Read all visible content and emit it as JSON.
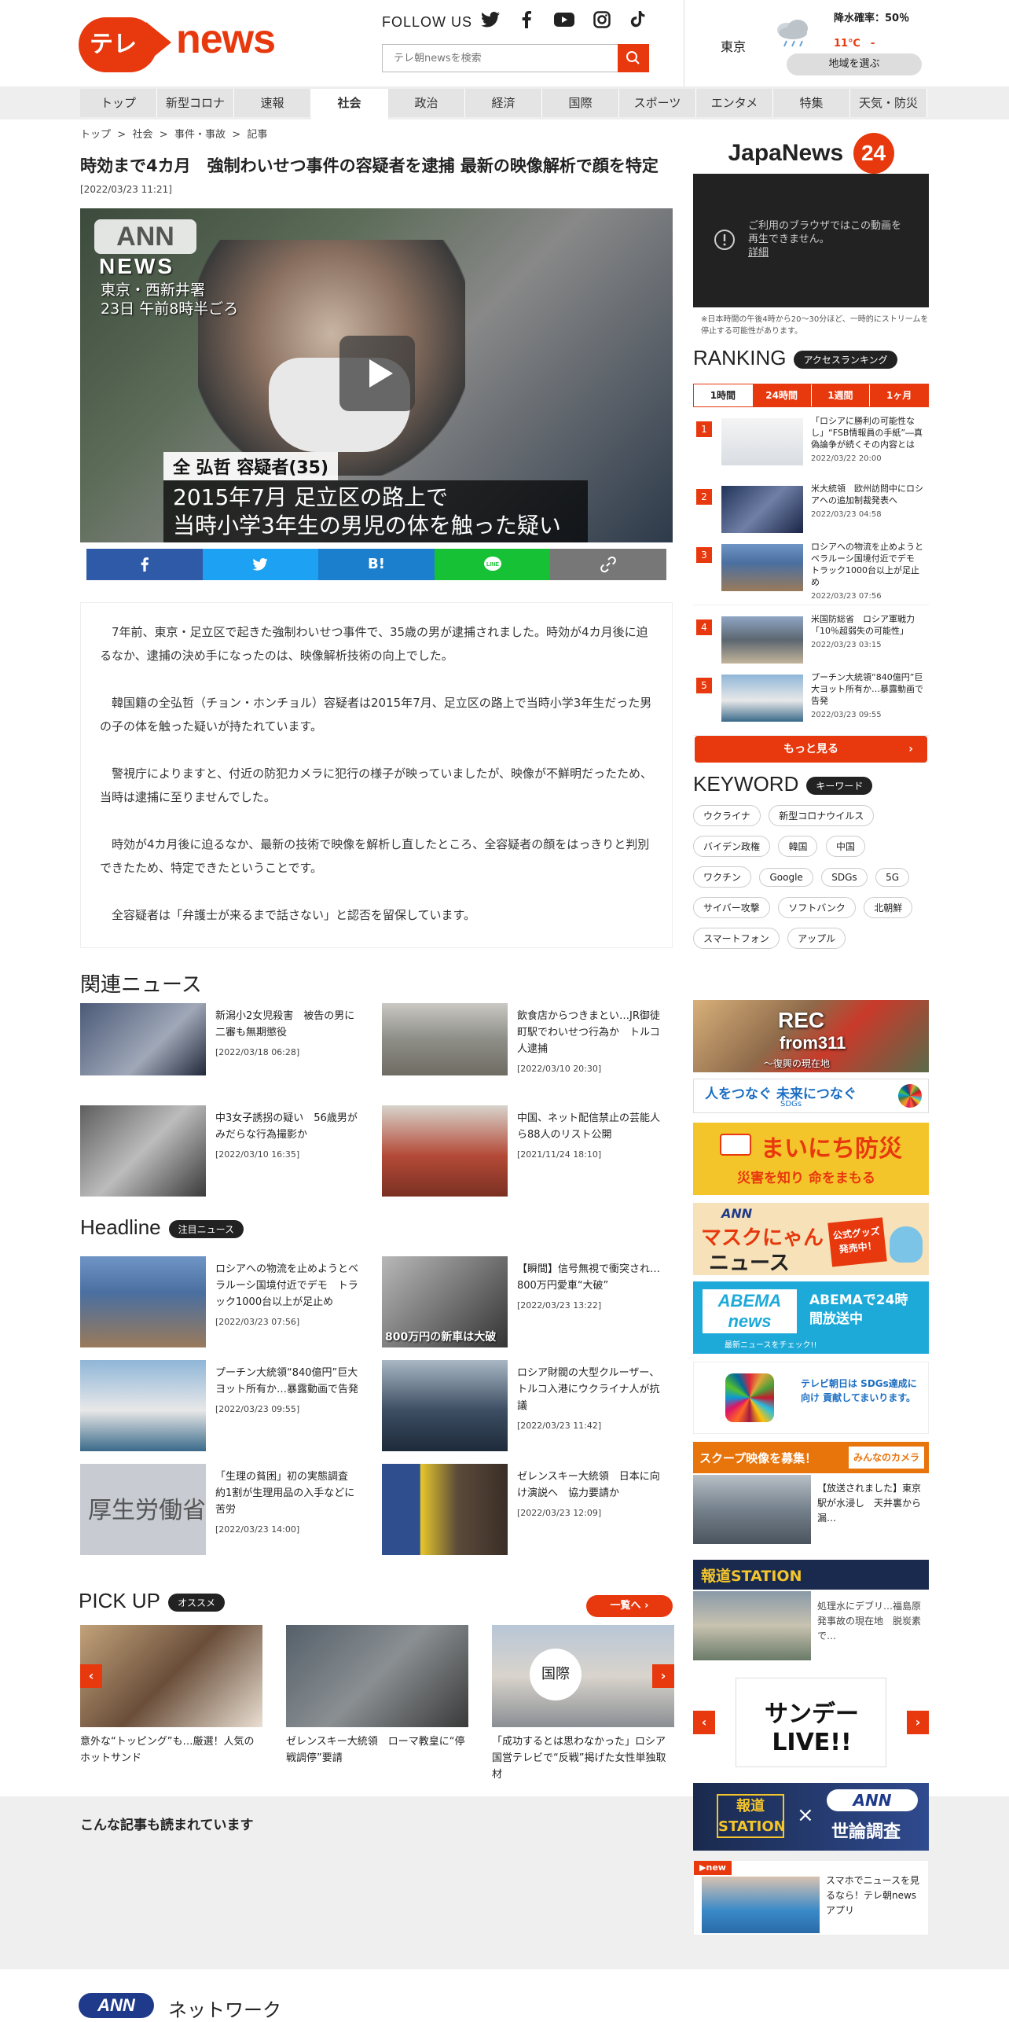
{
  "header": {
    "logo_pill": "テレ朝",
    "logo_word": "news",
    "follow_us": "FOLLOW US",
    "search_placeholder": "テレ朝newsを検索",
    "weather": {
      "city": "東京",
      "rain": "降水確率：50％",
      "temp": "11℃　-",
      "select_region": "地域を選ぶ"
    }
  },
  "nav": [
    "トップ",
    "新型コロナ",
    "速報",
    "社会",
    "政治",
    "経済",
    "国際",
    "スポーツ",
    "エンタメ",
    "特集",
    "天気・防災"
  ],
  "breadcrumb": [
    "トップ",
    "社会",
    "事件・事故",
    "記事"
  ],
  "article": {
    "title": "時効まで4カ月　強制わいせつ事件の容疑者を逮捕 最新の映像解析で顔を特定",
    "date": "[2022/03/23 11:21]",
    "video": {
      "logo": "ANN",
      "logo_sub": "NEWS",
      "location": "東京・西新井署",
      "time": "23日 午前8時半ごろ",
      "name_caption": "全 弘哲 容疑者(35)",
      "caption_line1": "2015年7月 足立区の路上で",
      "caption_line2": "当時小学3年生の男児の体を触った疑い"
    },
    "paragraphs": [
      "7年前、東京・足立区で起きた強制わいせつ事件で、35歳の男が逮捕されました。時効が4カ月後に迫るなか、逮捕の決め手になったのは、映像解析技術の向上でした。",
      "韓国籍の全弘哲（チョン・ホンチョル）容疑者は2015年7月、足立区の路上で当時小学3年生だった男の子の体を触った疑いが持たれています。",
      "警視庁によりますと、付近の防犯カメラに犯行の様子が映っていましたが、映像が不鮮明だったため、当時は逮捕に至りませんでした。",
      "時効が4カ月後に迫るなか、最新の技術で映像を解析し直したところ、全容疑者の顔をはっきりと判別できたため、特定できたということです。",
      "全容疑者は「弁護士が来るまで話さない」と認否を留保しています。"
    ]
  },
  "related": {
    "heading": "関連ニュース",
    "items": [
      {
        "title": "新潟小2女児殺害　被告の男に二審も無期懲役",
        "date": "[2022/03/18 06:28]"
      },
      {
        "title": "飲食店からつきまとい…JR御徒町駅でわいせつ行為か　トルコ人逮捕",
        "date": "[2022/03/10 20:30]"
      },
      {
        "title": "中3女子誘拐の疑い　56歳男がみだらな行為撮影か",
        "date": "[2022/03/10 16:35]"
      },
      {
        "title": "中国、ネット配信禁止の芸能人ら88人のリスト公開",
        "date": "[2021/11/24 18:10]"
      }
    ]
  },
  "headline": {
    "heading": "Headline",
    "tag": "注目ニュース",
    "items": [
      {
        "title": "ロシアへの物流を止めようとベラルーシ国境付近でデモ　トラック1000台以上が足止め",
        "date": "[2022/03/23 07:56]"
      },
      {
        "title": "【瞬間】信号無視で衝突され…800万円愛車“大破”",
        "date": "[2022/03/23 13:22]"
      },
      {
        "title": "プーチン大統領“840億円”巨大ヨット所有か…暴露動画で告発",
        "date": "[2022/03/23 09:55]"
      },
      {
        "title": "ロシア財閥の大型クルーザー、トルコ入港にウクライナ人が抗議",
        "date": "[2022/03/23 11:42]"
      },
      {
        "title": "「生理の貧困」初の実態調査　約1割が生理用品の入手などに苦労",
        "date": "[2022/03/23 14:00]"
      },
      {
        "title": "ゼレンスキー大統領　日本に向け演説へ　協力要請か",
        "date": "[2022/03/23 12:09]"
      }
    ],
    "thumb_text_2": "800万円の新車は大破",
    "thumb_text_5": "厚生労働省"
  },
  "pickup": {
    "heading": "PICK UP",
    "tag": "オススメ",
    "list_button": "一覧へ ›",
    "items": [
      {
        "title": "意外な“トッピング”も…厳選！人気のホットサンド"
      },
      {
        "title": "ゼレンスキー大統領　ローマ教皇に“停戦調停”要請"
      },
      {
        "title": "「成功するとは思わなかった」ロシア国営テレビで“反戦”掲げた女性単独取材"
      }
    ],
    "thumb_label_3": "国際"
  },
  "also_read": "こんな記事も読まれています",
  "footer": {
    "logo": "ANN",
    "text": "ネットワーク"
  },
  "sidebar": {
    "japanews_logo": "JapaNews",
    "japanews_num": "24",
    "player_msg": "ご利用のブラウザではこの動画を再生できません。",
    "player_link": "詳細",
    "note": "※日本時間の午後4時から20～30分ほど、一時的にストリームを停止する可能性があります。",
    "ranking_heading": "RANKING",
    "ranking_tag": "アクセスランキング",
    "ranking_tabs": [
      "1時間",
      "24時間",
      "1週間",
      "1ヶ月"
    ],
    "ranking": [
      {
        "num": "1",
        "title": "「ロシアに勝利の可能性なし」“FSB情報員の手紙”―真偽論争が続くその内容とは",
        "date": "2022/03/22 20:00"
      },
      {
        "num": "2",
        "title": "米大統領　欧州訪問中にロシアへの追加制裁発表へ",
        "date": "2022/03/23 04:58"
      },
      {
        "num": "3",
        "title": "ロシアへの物流を止めようとベラルーシ国境付近でデモ　トラック1000台以上が足止め",
        "date": "2022/03/23 07:56"
      },
      {
        "num": "4",
        "title": "米国防総省　ロシア軍戦力「10％超弱失の可能性」",
        "date": "2022/03/23 03:15"
      },
      {
        "num": "5",
        "title": "プーチン大統領“840億円”巨大ヨット所有か…暴露動画で告発",
        "date": "2022/03/23 09:55"
      }
    ],
    "more": "もっと見る",
    "keyword_heading": "KEYWORD",
    "keyword_tag": "キーワード",
    "keywords": [
      "ウクライナ",
      "新型コロナウイルス",
      "バイデン政権",
      "韓国",
      "中国",
      "ワクチン",
      "Google",
      "SDGs",
      "5G",
      "サイバー攻撃",
      "ソフトバンク",
      "北朝鮮",
      "スマートフォン",
      "アップル"
    ],
    "banners": {
      "rec_title": "REC",
      "rec_sub": "from311",
      "rec_caption": "～復興の現在地",
      "sdgs_text": "人をつなぐ 未来につなぐ",
      "sdgs_sub": "SDGs",
      "bousai_title": "まいにち防災",
      "bousai_sub": "災害を知り 命をまもる",
      "mascot_line1": "ANN",
      "mascot_line2": "マスクにゃん",
      "mascot_line3": "ニュース",
      "mascot_badge": "公式グッズ発売中！",
      "abema_logo": "ABEMA news",
      "abema_text": "ABEMAで24時間放送中",
      "abema_sub": "最新ニュースをチェック!!",
      "sdg_text": "テレビ朝日は SDGs達成に向け 貢献してまいります。",
      "scoop_head": "スクープ映像を募集！",
      "scoop_brand": "みんなのカメラ",
      "scoop_text": "【放送されました】東京駅が水浸し　天井裏から漏…",
      "houdou_head": "報道STATION",
      "houdou_text": "処理水にデブリ…福島原発事故の現在地　脱炭素で…",
      "sunday_live": "サンデーLIVE!!",
      "poll_left": "報道 STATION",
      "poll_right_top": "ANN",
      "poll_right_bot": "世論調査",
      "app_new": "▶new",
      "app_text": "スマホでニュースを見るなら！テレ朝newsアプリ"
    }
  },
  "colors": {
    "brand": "#e8380d",
    "facebook": "#2f5aa8",
    "twitter": "#1da1f2",
    "hatena": "#1b7fce",
    "line": "#16c135",
    "link": "#777777"
  }
}
